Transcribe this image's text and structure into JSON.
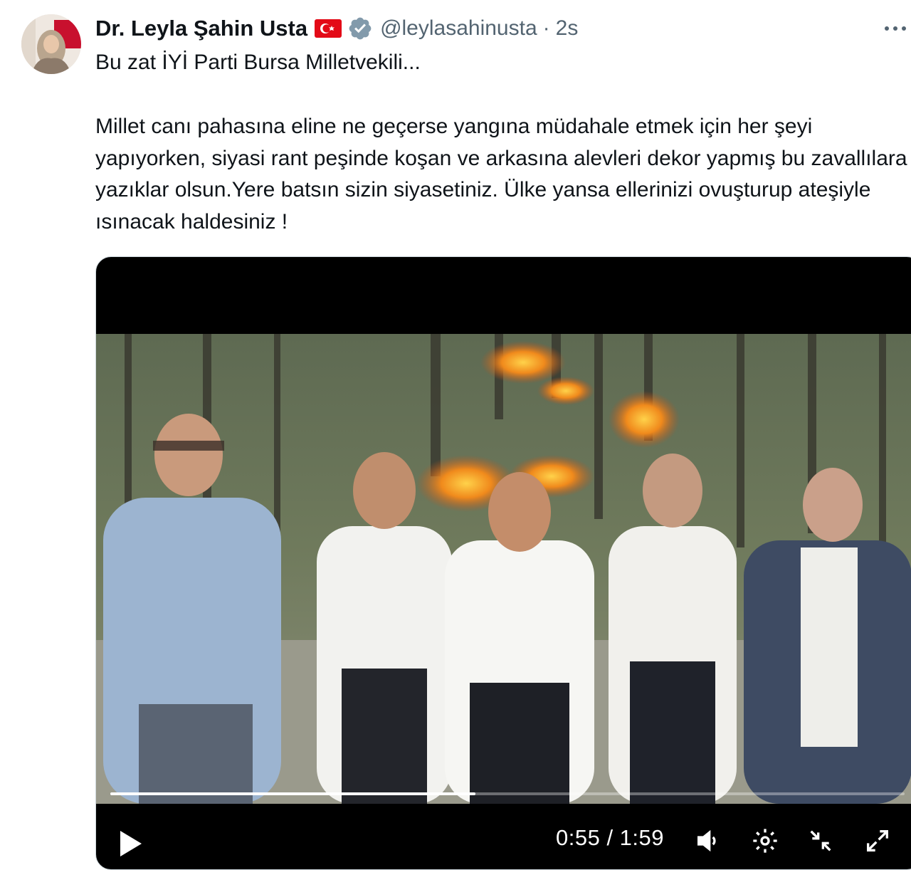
{
  "author": {
    "name": "Dr. Leyla Şahin Usta",
    "handle": "@leylasahinusta",
    "time": "2s",
    "separator": "·"
  },
  "icons": {
    "flag": "turkey-flag-icon",
    "verified": "verified-badge-icon",
    "more": "more-options-icon",
    "play": "play-icon",
    "volume": "volume-icon",
    "settings": "settings-icon",
    "minimize": "minimize-icon",
    "fullscreen": "fullscreen-icon"
  },
  "tweet": {
    "first_line": "Bu zat İYİ Parti Bursa Milletvekili...",
    "body": "Millet canı pahasına eline ne geçerse yangına müdahale etmek için her şeyi yapıyorken, siyasi rant peşinde koşan ve arkasına alevleri dekor yapmış bu zavallılara yazıklar olsun.Yere batsın sizin siyasetiniz. Ülke yansa ellerinizi ovuşturup ateşiyle ısınacak haldesiniz !"
  },
  "video": {
    "time_display": "0:55 / 1:59",
    "progress_fraction": 0.46
  },
  "colors": {
    "text": "#0f1419",
    "secondary": "#536471",
    "verified": "#829aab",
    "flag_red": "#e30a17"
  }
}
